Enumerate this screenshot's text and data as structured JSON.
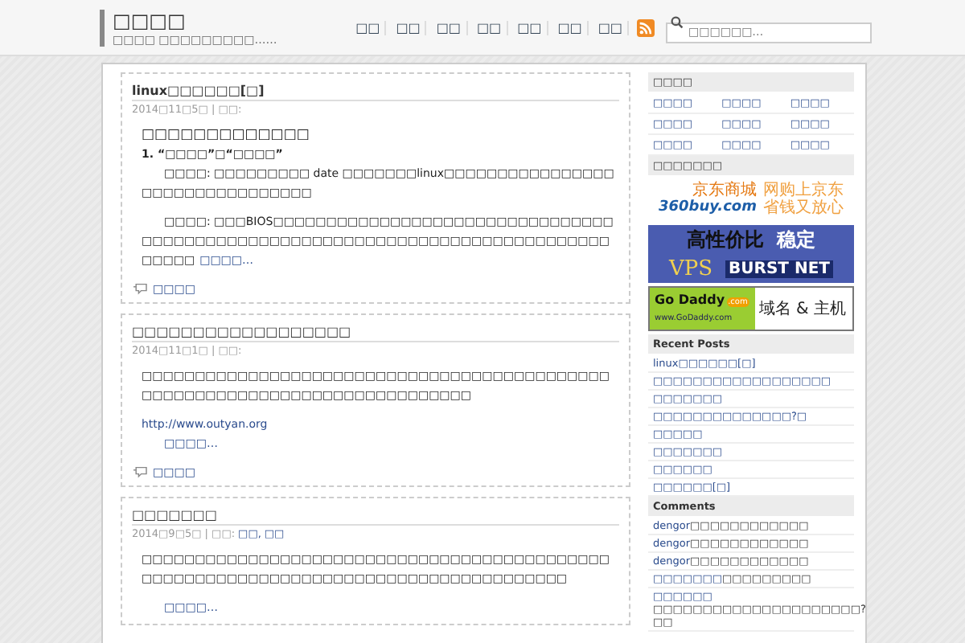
{
  "header": {
    "title": "□□□□",
    "tagline": "□□□□ □□□□□□□□□……",
    "nav": [
      "□□",
      "□□",
      "□□",
      "□□",
      "□□",
      "□□",
      "□□"
    ],
    "search": {
      "placeholder": "□□□□□□…"
    }
  },
  "posts": [
    {
      "title": "linux□□□□□□[□]",
      "meta": "2014□11□5□ | □□:",
      "comments": "□□□□",
      "body": [
        {
          "kind": "heading",
          "text": "□□□□□□□□□□□□□"
        },
        {
          "kind": "subheading",
          "text": "1. “□□□□”□“□□□□”"
        },
        {
          "kind": "indent",
          "text": "□□□□: □□□□□□□□□ date □□□□□□□linux□□□□□□□□□□□□□□□□□□□□□□□□□□□□□□□□"
        },
        {
          "kind": "indent",
          "text": "□□□□: □□□BIOS□□□□□□□□□□□□□□□□□□□□□□□□□□□□□□□□□□□□□□□□□□□□□□□□□□□□□□□□□□□□□□□□□□□□□□□□□□□□□□□□□",
          "more": "□□□□…"
        }
      ]
    },
    {
      "title": "□□□□□□□□□□□□□□□□□□",
      "meta": "2014□11□1□ | □□:",
      "comments": "□□□□",
      "body": [
        {
          "kind": "paragraph",
          "text": "□□□□□□□□□□□□□□□□□□□□□□□□□□□□□□□□□□□□□□□□□□□□□□□□□□□□□□□□□□□□□□□□□□□□□□□□□□□"
        },
        {
          "kind": "link",
          "text": "http://www.outyan.org"
        },
        {
          "kind": "more",
          "text": "□□□□…"
        }
      ]
    },
    {
      "title": "□□□□□□□",
      "meta": "2014□9□5□ | □□:",
      "tags": [
        "□□,",
        "□□"
      ],
      "body": [
        {
          "kind": "paragraph",
          "text": "□□□□□□□□□□□□□□□□□□□□□□□□□□□□□□□□□□□□□□□□□□□□□□□□□□□□□□□□□□□□□□□□□□□□□□□□□□□□□□□□□□□□"
        },
        {
          "kind": "more",
          "text": "□□□□…"
        }
      ]
    }
  ],
  "sidebar": [
    {
      "kind": "grid",
      "title": "□□□□",
      "items": [
        "□□□□",
        "□□□□",
        "□□□□",
        "□□□□",
        "□□□□",
        "□□□□",
        "□□□□",
        "□□□□",
        "□□□□"
      ]
    },
    {
      "kind": "ads",
      "title": "□□□□□□□",
      "ads": [
        {
          "kind": "shop",
          "brand": "360buy.com",
          "name": "京东商城",
          "slogan": [
            "网购上京东",
            "省钱又放心"
          ]
        },
        {
          "kind": "vps",
          "line1": "高性价比",
          "line2": "稳定",
          "product": "VPS",
          "brand": "BURST NET"
        },
        {
          "kind": "domain",
          "brand": "Go Daddy",
          "suffix": ".com",
          "url": "www.GoDaddy.com",
          "text": "域名 & 主机"
        }
      ]
    },
    {
      "kind": "list",
      "title": "Recent Posts",
      "items": [
        "linux□□□□□□[□]",
        "□□□□□□□□□□□□□□□□□□",
        "□□□□□□□",
        "□□□□□□□□□□□□□□?□",
        "□□□□□",
        "□□□□□□□",
        "□□□□□□",
        "□□□□□□[□]"
      ]
    },
    {
      "kind": "comments",
      "title": "Comments",
      "items": [
        {
          "author": "dengor",
          "text": "□□□□□□□□□□□□"
        },
        {
          "author": "dengor",
          "text": "□□□□□□□□□□□□"
        },
        {
          "author": "dengor",
          "text": "□□□□□□□□□□□□"
        },
        {
          "author": "□□□□□□□",
          "text": "□□□□□□□□□"
        },
        {
          "author": "□□□□□□",
          "text": "□□□□□□□□□□□□□□□□□□□□□?□□"
        }
      ]
    }
  ]
}
